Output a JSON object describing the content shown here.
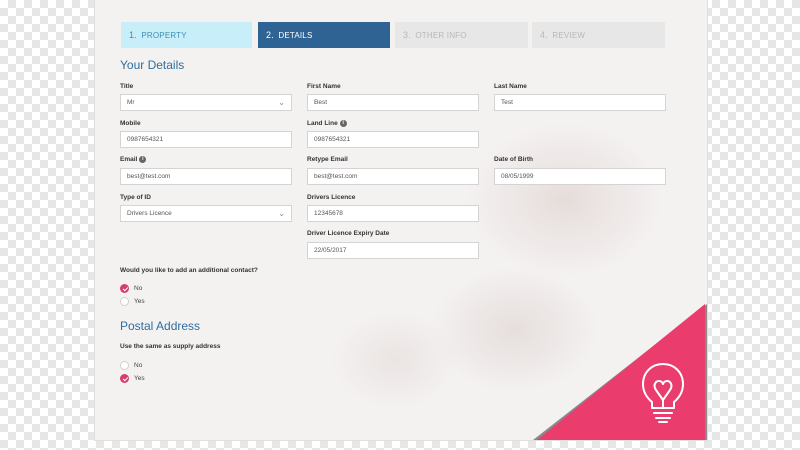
{
  "steps": [
    {
      "num": "1.",
      "label": "PROPERTY",
      "state": "completed"
    },
    {
      "num": "2.",
      "label": "DETAILS",
      "state": "active"
    },
    {
      "num": "3.",
      "label": "OTHER INFO",
      "state": "upcoming"
    },
    {
      "num": "4.",
      "label": "REVIEW",
      "state": "upcoming"
    }
  ],
  "your_details": {
    "heading": "Your Details",
    "title": {
      "label": "Title",
      "value": "Mr"
    },
    "first_name": {
      "label": "First Name",
      "value": "Best"
    },
    "last_name": {
      "label": "Last Name",
      "value": "Test"
    },
    "mobile": {
      "label": "Mobile",
      "value": "0987654321"
    },
    "land_line": {
      "label": "Land Line",
      "value": "0987654321"
    },
    "email": {
      "label": "Email",
      "value": "best@test.com"
    },
    "retype_email": {
      "label": "Retype Email",
      "value": "best@test.com"
    },
    "date_of_birth": {
      "label": "Date of Birth",
      "value": "08/05/1999"
    },
    "type_of_id": {
      "label": "Type of ID",
      "value": "Drivers Licence"
    },
    "drivers_licence": {
      "label": "Drivers Licence",
      "value": "12345678"
    },
    "licence_expiry": {
      "label": "Driver Licence Expiry Date",
      "value": "22/05/2017"
    }
  },
  "additional_contact": {
    "question": "Would you like to add an additional contact?",
    "options": [
      {
        "label": "No",
        "checked": true
      },
      {
        "label": "Yes",
        "checked": false
      }
    ]
  },
  "postal_address": {
    "heading": "Postal Address",
    "question": "Use the same as supply address",
    "options": [
      {
        "label": "No",
        "checked": false
      },
      {
        "label": "Yes",
        "checked": true
      }
    ]
  },
  "colors": {
    "accent_pink": "#ea3d6d",
    "step_active": "#2e6394",
    "step_completed": "#c8eefa",
    "heading_blue": "#2f6e9f"
  },
  "icons": {
    "corner_icon": "lightbulb-heart-icon",
    "select_caret": "chevron-down-icon",
    "info": "info-icon"
  }
}
